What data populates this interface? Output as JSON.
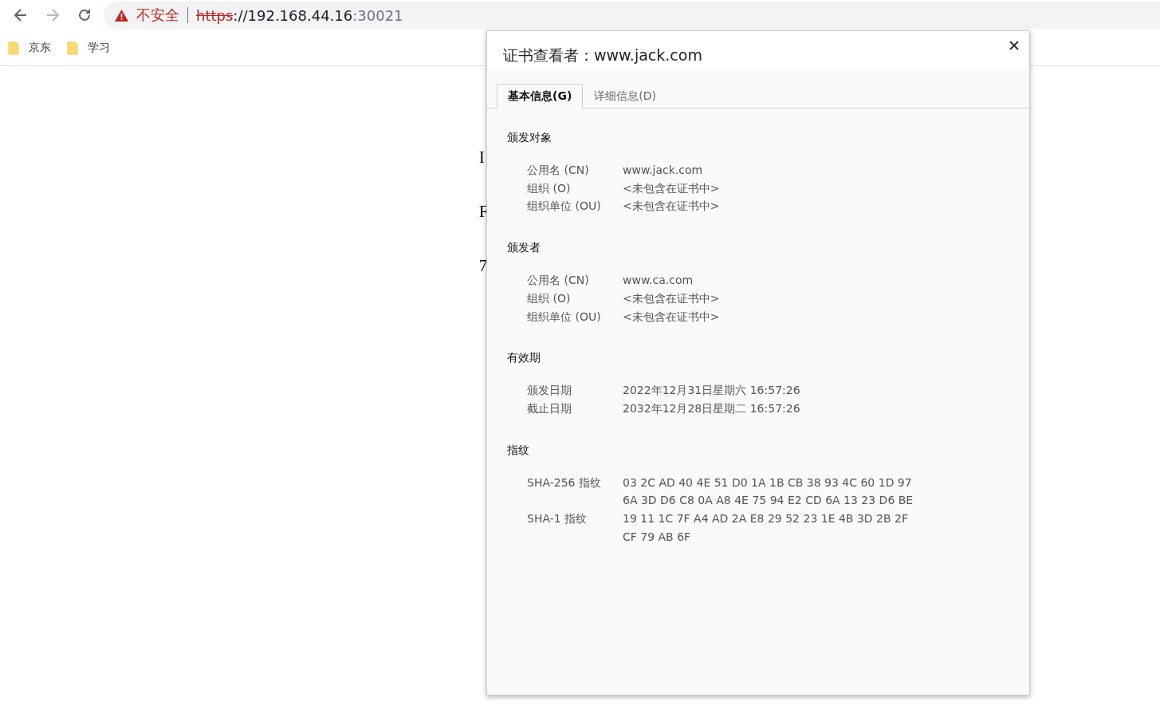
{
  "toolbar": {
    "security_label": "不安全",
    "url": {
      "scheme": "https",
      "host": "://192.168.44.16",
      "port": ":30021"
    }
  },
  "bookmarks": [
    "京东",
    "学习"
  ],
  "page_fragments": [
    {
      "text": "I",
      "kind": "line"
    },
    {
      "text": "F",
      "kind": "para"
    },
    {
      "text": "7",
      "kind": "para"
    }
  ],
  "dialog": {
    "title": "证书查看者：www.jack.com",
    "tabs": [
      {
        "label": "基本信息(G)",
        "selected": true
      },
      {
        "label": "详细信息(D)",
        "selected": false
      }
    ],
    "sections": [
      {
        "heading": "颁发对象",
        "rows": [
          {
            "label": "公用名 (CN)",
            "lines": [
              "www.jack.com"
            ]
          },
          {
            "label": "组织 (O)",
            "lines": [
              "<未包含在证书中>"
            ]
          },
          {
            "label": "组织单位 (OU)",
            "lines": [
              "<未包含在证书中>"
            ]
          }
        ]
      },
      {
        "heading": "颁发者",
        "rows": [
          {
            "label": "公用名 (CN)",
            "lines": [
              "www.ca.com"
            ]
          },
          {
            "label": "组织 (O)",
            "lines": [
              "<未包含在证书中>"
            ]
          },
          {
            "label": "组织单位 (OU)",
            "lines": [
              "<未包含在证书中>"
            ]
          }
        ]
      },
      {
        "heading": "有效期",
        "rows": [
          {
            "label": "颁发日期",
            "lines": [
              "2022年12月31日星期六 16:57:26"
            ]
          },
          {
            "label": "截止日期",
            "lines": [
              "2032年12月28日星期二 16:57:26"
            ]
          }
        ]
      },
      {
        "heading": "指纹",
        "rows": [
          {
            "label": "SHA-256 指纹",
            "lines": [
              "03 2C AD 40 4E 51 D0 1A 1B CB 38 93 4C 60 1D 97",
              "6A 3D D6 C8 0A A8 4E 75 94 E2 CD 6A 13 23 D6 BE"
            ]
          },
          {
            "label": "SHA-1 指纹",
            "lines": [
              "19 11 1C 7F A4 AD 2A E8 29 52 23 1E 4B 3D 2B 2F",
              "CF 79 AB 6F"
            ]
          }
        ]
      }
    ]
  }
}
